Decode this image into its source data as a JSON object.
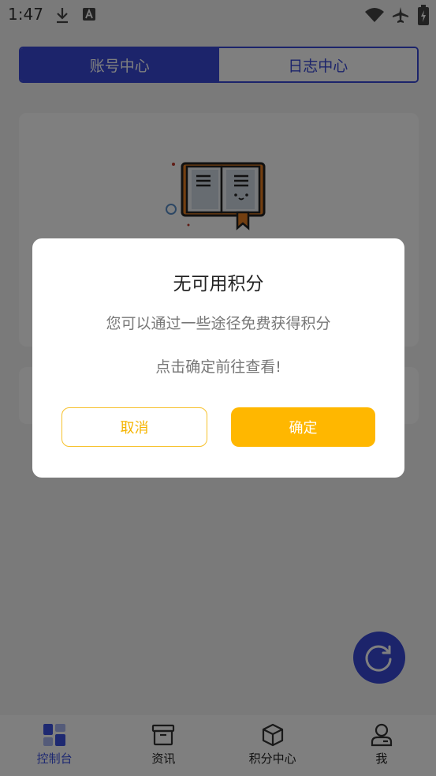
{
  "status_bar": {
    "time": "1:47",
    "icons": [
      "download-icon",
      "a-icon",
      "wifi-icon",
      "airplane-icon",
      "battery-icon"
    ]
  },
  "header": {
    "tabs": [
      {
        "label": "账号中心",
        "active": true
      },
      {
        "label": "日志中心",
        "active": false
      }
    ]
  },
  "dialog": {
    "title": "无可用积分",
    "line1": "您可以通过一些途径免费获得积分",
    "line2": "点击确定前往查看!",
    "cancel_label": "取消",
    "confirm_label": "确定"
  },
  "bottom_nav": {
    "items": [
      {
        "label": "控制台",
        "icon": "dashboard-icon",
        "active": true
      },
      {
        "label": "资讯",
        "icon": "archive-icon",
        "active": false
      },
      {
        "label": "积分中心",
        "icon": "cube-icon",
        "active": false
      },
      {
        "label": "我",
        "icon": "user-icon",
        "active": false
      }
    ]
  },
  "colors": {
    "primary": "#3949d6",
    "accent": "#ffb700",
    "overlay": "rgba(0,0,0,0.5)"
  }
}
